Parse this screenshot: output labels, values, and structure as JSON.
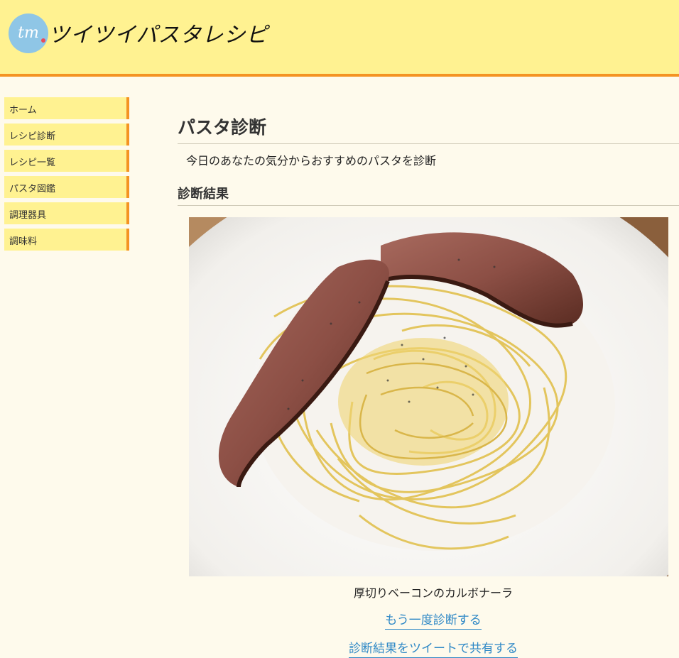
{
  "header": {
    "logo_text": "tm",
    "site_title": "ツイツイパスタレシピ"
  },
  "sidebar": {
    "items": [
      {
        "label": "ホーム"
      },
      {
        "label": "レシピ診断"
      },
      {
        "label": "レシピ一覧"
      },
      {
        "label": "パスタ図鑑"
      },
      {
        "label": "調理器具"
      },
      {
        "label": "調味料"
      }
    ]
  },
  "main": {
    "title": "パスタ診断",
    "lead": "今日のあなたの気分からおすすめのパスタを診断",
    "result_heading": "診断結果",
    "result_name": "厚切りベーコンのカルボナーラ",
    "retry_link": "もう一度診断する",
    "share_link": "診断結果をツイートで共有する"
  },
  "colors": {
    "header_bg": "#fff291",
    "accent": "#f49322",
    "link": "#2e88c6",
    "page_bg": "#fefaec"
  }
}
